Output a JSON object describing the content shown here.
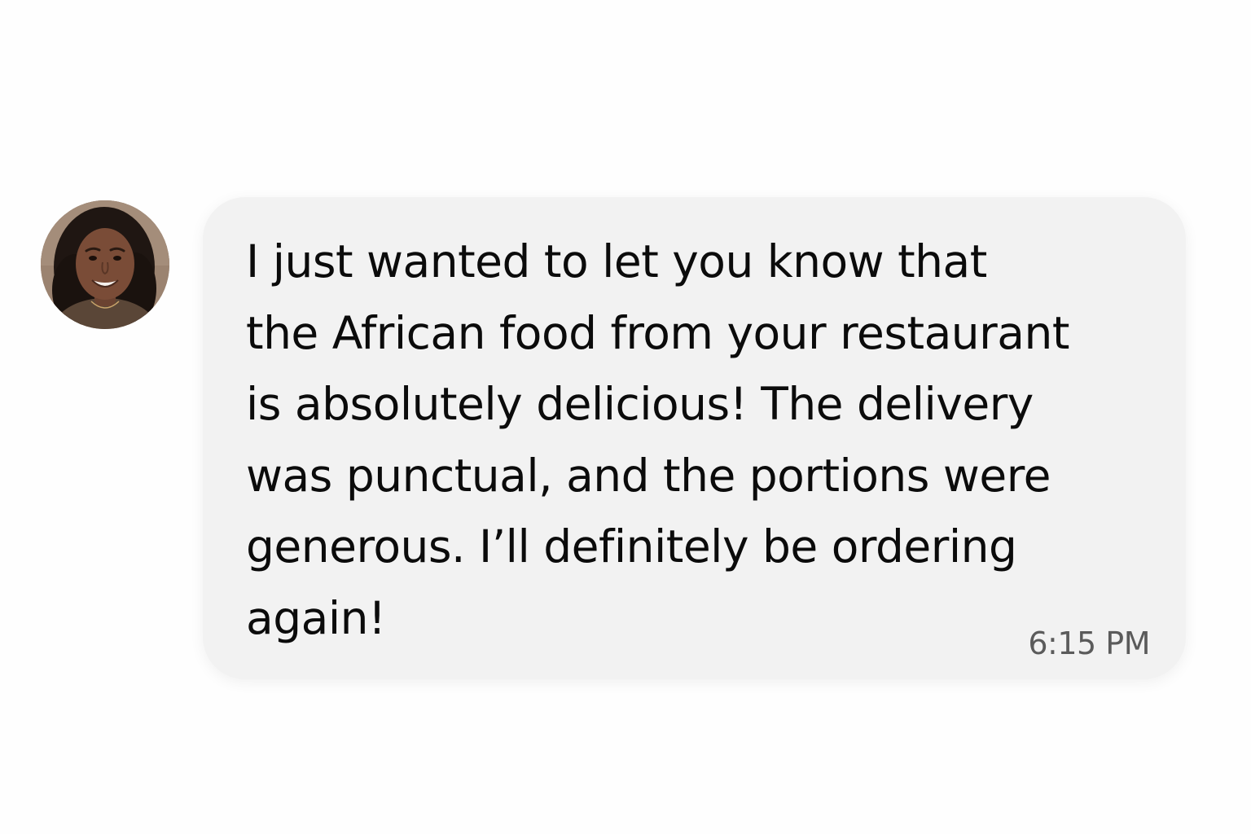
{
  "message": {
    "sender_avatar": "avatar-photo",
    "lines": [
      "I just wanted to let you know that",
      "the African food from your restaurant",
      "is absolutely delicious! The delivery",
      "was punctual, and the portions were",
      "generous. I’ll definitely be ordering",
      "again!"
    ],
    "timestamp": "6:15 PM"
  },
  "colors": {
    "background": "#fefefe",
    "bubble": "#f2f2f2",
    "text": "#0b0b0b",
    "timestamp": "#5b5b5b"
  }
}
